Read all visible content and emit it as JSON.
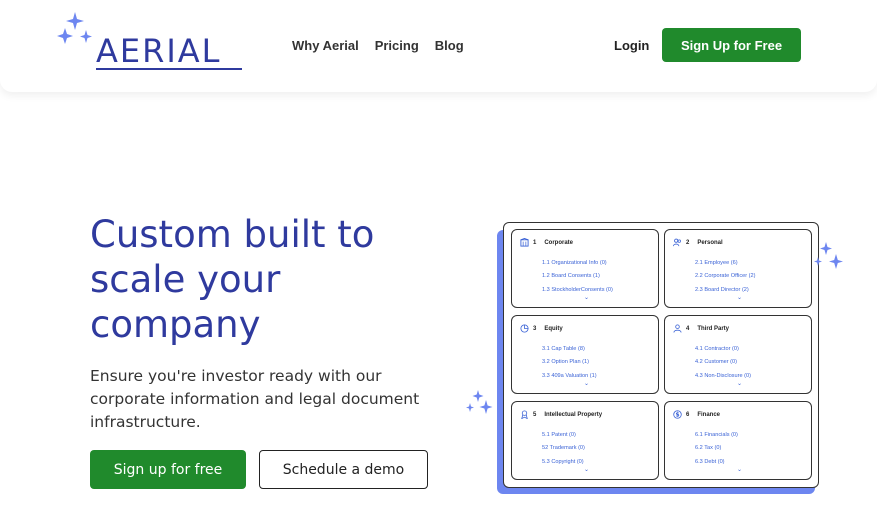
{
  "brand": {
    "name": "AERIAL",
    "color": "#2f3a9e",
    "accent": "#208a2c"
  },
  "nav": {
    "items": [
      {
        "label": "Why Aerial"
      },
      {
        "label": "Pricing"
      },
      {
        "label": "Blog"
      }
    ],
    "login_label": "Login",
    "signup_label": "Sign Up for Free"
  },
  "hero": {
    "title": "Custom built to scale your company",
    "subtitle": "Ensure you're investor ready with our corporate information and legal document infrastructure.",
    "cta_primary": "Sign up for free",
    "cta_secondary": "Schedule a demo"
  },
  "illustration": {
    "cards": [
      {
        "num": "1",
        "title": "Corporate",
        "icon": "building-icon",
        "items": [
          "1.1  Organizational Info (0)",
          "1.2  Board Consents (1)",
          "1.3  StockholderConsents (0)"
        ]
      },
      {
        "num": "2",
        "title": "Personal",
        "icon": "users-icon",
        "items": [
          "2.1  Employee (6)",
          "2.2  Corporate Officer (2)",
          "2.3  Board Director (2)"
        ]
      },
      {
        "num": "3",
        "title": "Equity",
        "icon": "pie-chart-icon",
        "items": [
          "3.1  Cap Table (8)",
          "3.2  Option Plan (1)",
          "3.3  409a Valuation (1)"
        ]
      },
      {
        "num": "4",
        "title": "Third Party",
        "icon": "user-icon",
        "items": [
          "4.1  Contractor (0)",
          "4.2  Customer (0)",
          "4.3  Non-Disclosure (0)"
        ]
      },
      {
        "num": "5",
        "title": "Intellectual Property",
        "icon": "certificate-icon",
        "items": [
          "5.1  Patent (0)",
          "52  Trademark (0)",
          "5.3  Copyright (0)"
        ]
      },
      {
        "num": "6",
        "title": "Finance",
        "icon": "dollar-coin-icon",
        "items": [
          "6.1  Financials (0)",
          "6.2  Tax (0)",
          "6.3  Debt (0)"
        ]
      }
    ]
  }
}
